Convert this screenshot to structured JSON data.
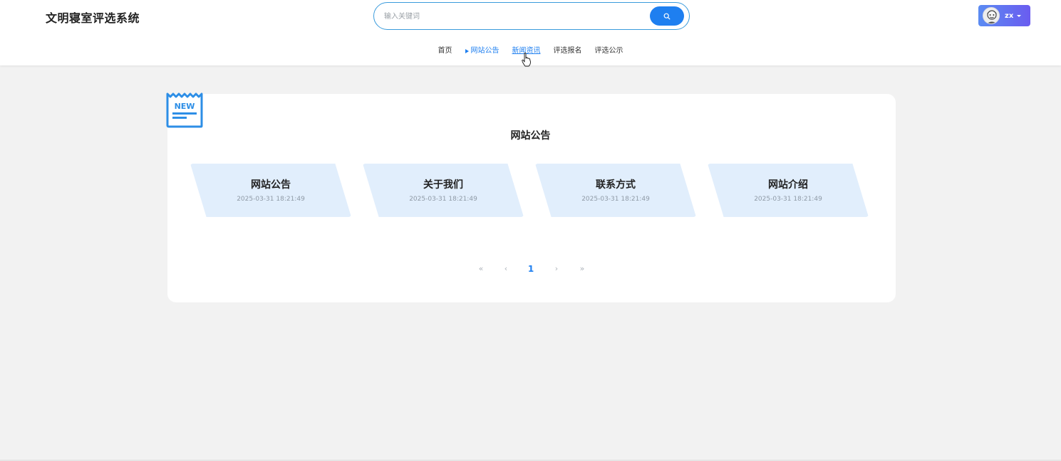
{
  "header": {
    "site_title": "文明寝室评选系统",
    "search": {
      "placeholder": "输入关键词",
      "value": ""
    },
    "user": {
      "name": "zx"
    }
  },
  "nav": {
    "items": [
      {
        "label": "首页",
        "state": "normal"
      },
      {
        "label": "网站公告",
        "state": "active"
      },
      {
        "label": "新闻资讯",
        "state": "hover"
      },
      {
        "label": "评选报名",
        "state": "normal"
      },
      {
        "label": "评选公示",
        "state": "normal"
      }
    ]
  },
  "main": {
    "badge_text": "NEW",
    "section_title": "网站公告",
    "notices": [
      {
        "title": "网站公告",
        "date": "2025-03-31 18:21:49"
      },
      {
        "title": "关于我们",
        "date": "2025-03-31 18:21:49"
      },
      {
        "title": "联系方式",
        "date": "2025-03-31 18:21:49"
      },
      {
        "title": "网站介绍",
        "date": "2025-03-31 18:21:49"
      }
    ]
  },
  "pagination": {
    "first": "«",
    "prev": "‹",
    "current": "1",
    "next": "›",
    "last": "»"
  },
  "colors": {
    "accent": "#1e7ff0",
    "card_bg": "#e1eefc",
    "page_bg": "#f2f2f2",
    "user_gradient_start": "#5b8bf2",
    "user_gradient_end": "#6a5cf0"
  },
  "icons": {
    "search_button": "search-icon",
    "badge": "new-badge-icon",
    "user_caret": "caret-down-icon",
    "pointer": "hand-pointer-icon"
  }
}
